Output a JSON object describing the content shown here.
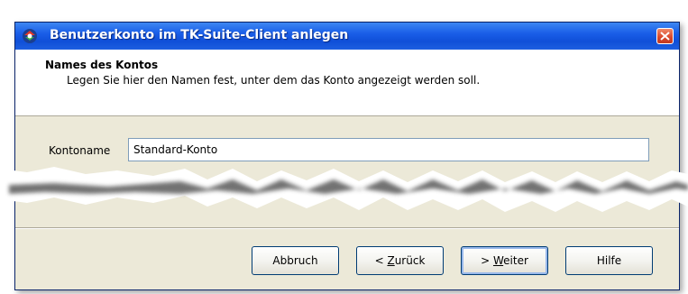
{
  "window": {
    "title": "Benutzerkonto im TK-Suite-Client anlegen"
  },
  "header": {
    "title": "Names des Kontos",
    "description": "Legen Sie hier den Namen fest, unter dem das Konto angezeigt werden soll."
  },
  "form": {
    "label": "Kontoname",
    "value": "Standard-Konto"
  },
  "buttons": {
    "cancel": "Abbruch",
    "back_prefix": "< ",
    "back_mnemonic": "Z",
    "back_rest": "urück",
    "next_prefix": "> ",
    "next_mnemonic": "W",
    "next_rest": "eiter",
    "help": "Hilfe"
  },
  "icons": {
    "title": "tk-suite-app-icon",
    "close": "close-icon"
  },
  "colors": {
    "titlebar": "#1a5ee8",
    "dialog_bg": "#ece9d8",
    "close_button": "#d9452a"
  }
}
